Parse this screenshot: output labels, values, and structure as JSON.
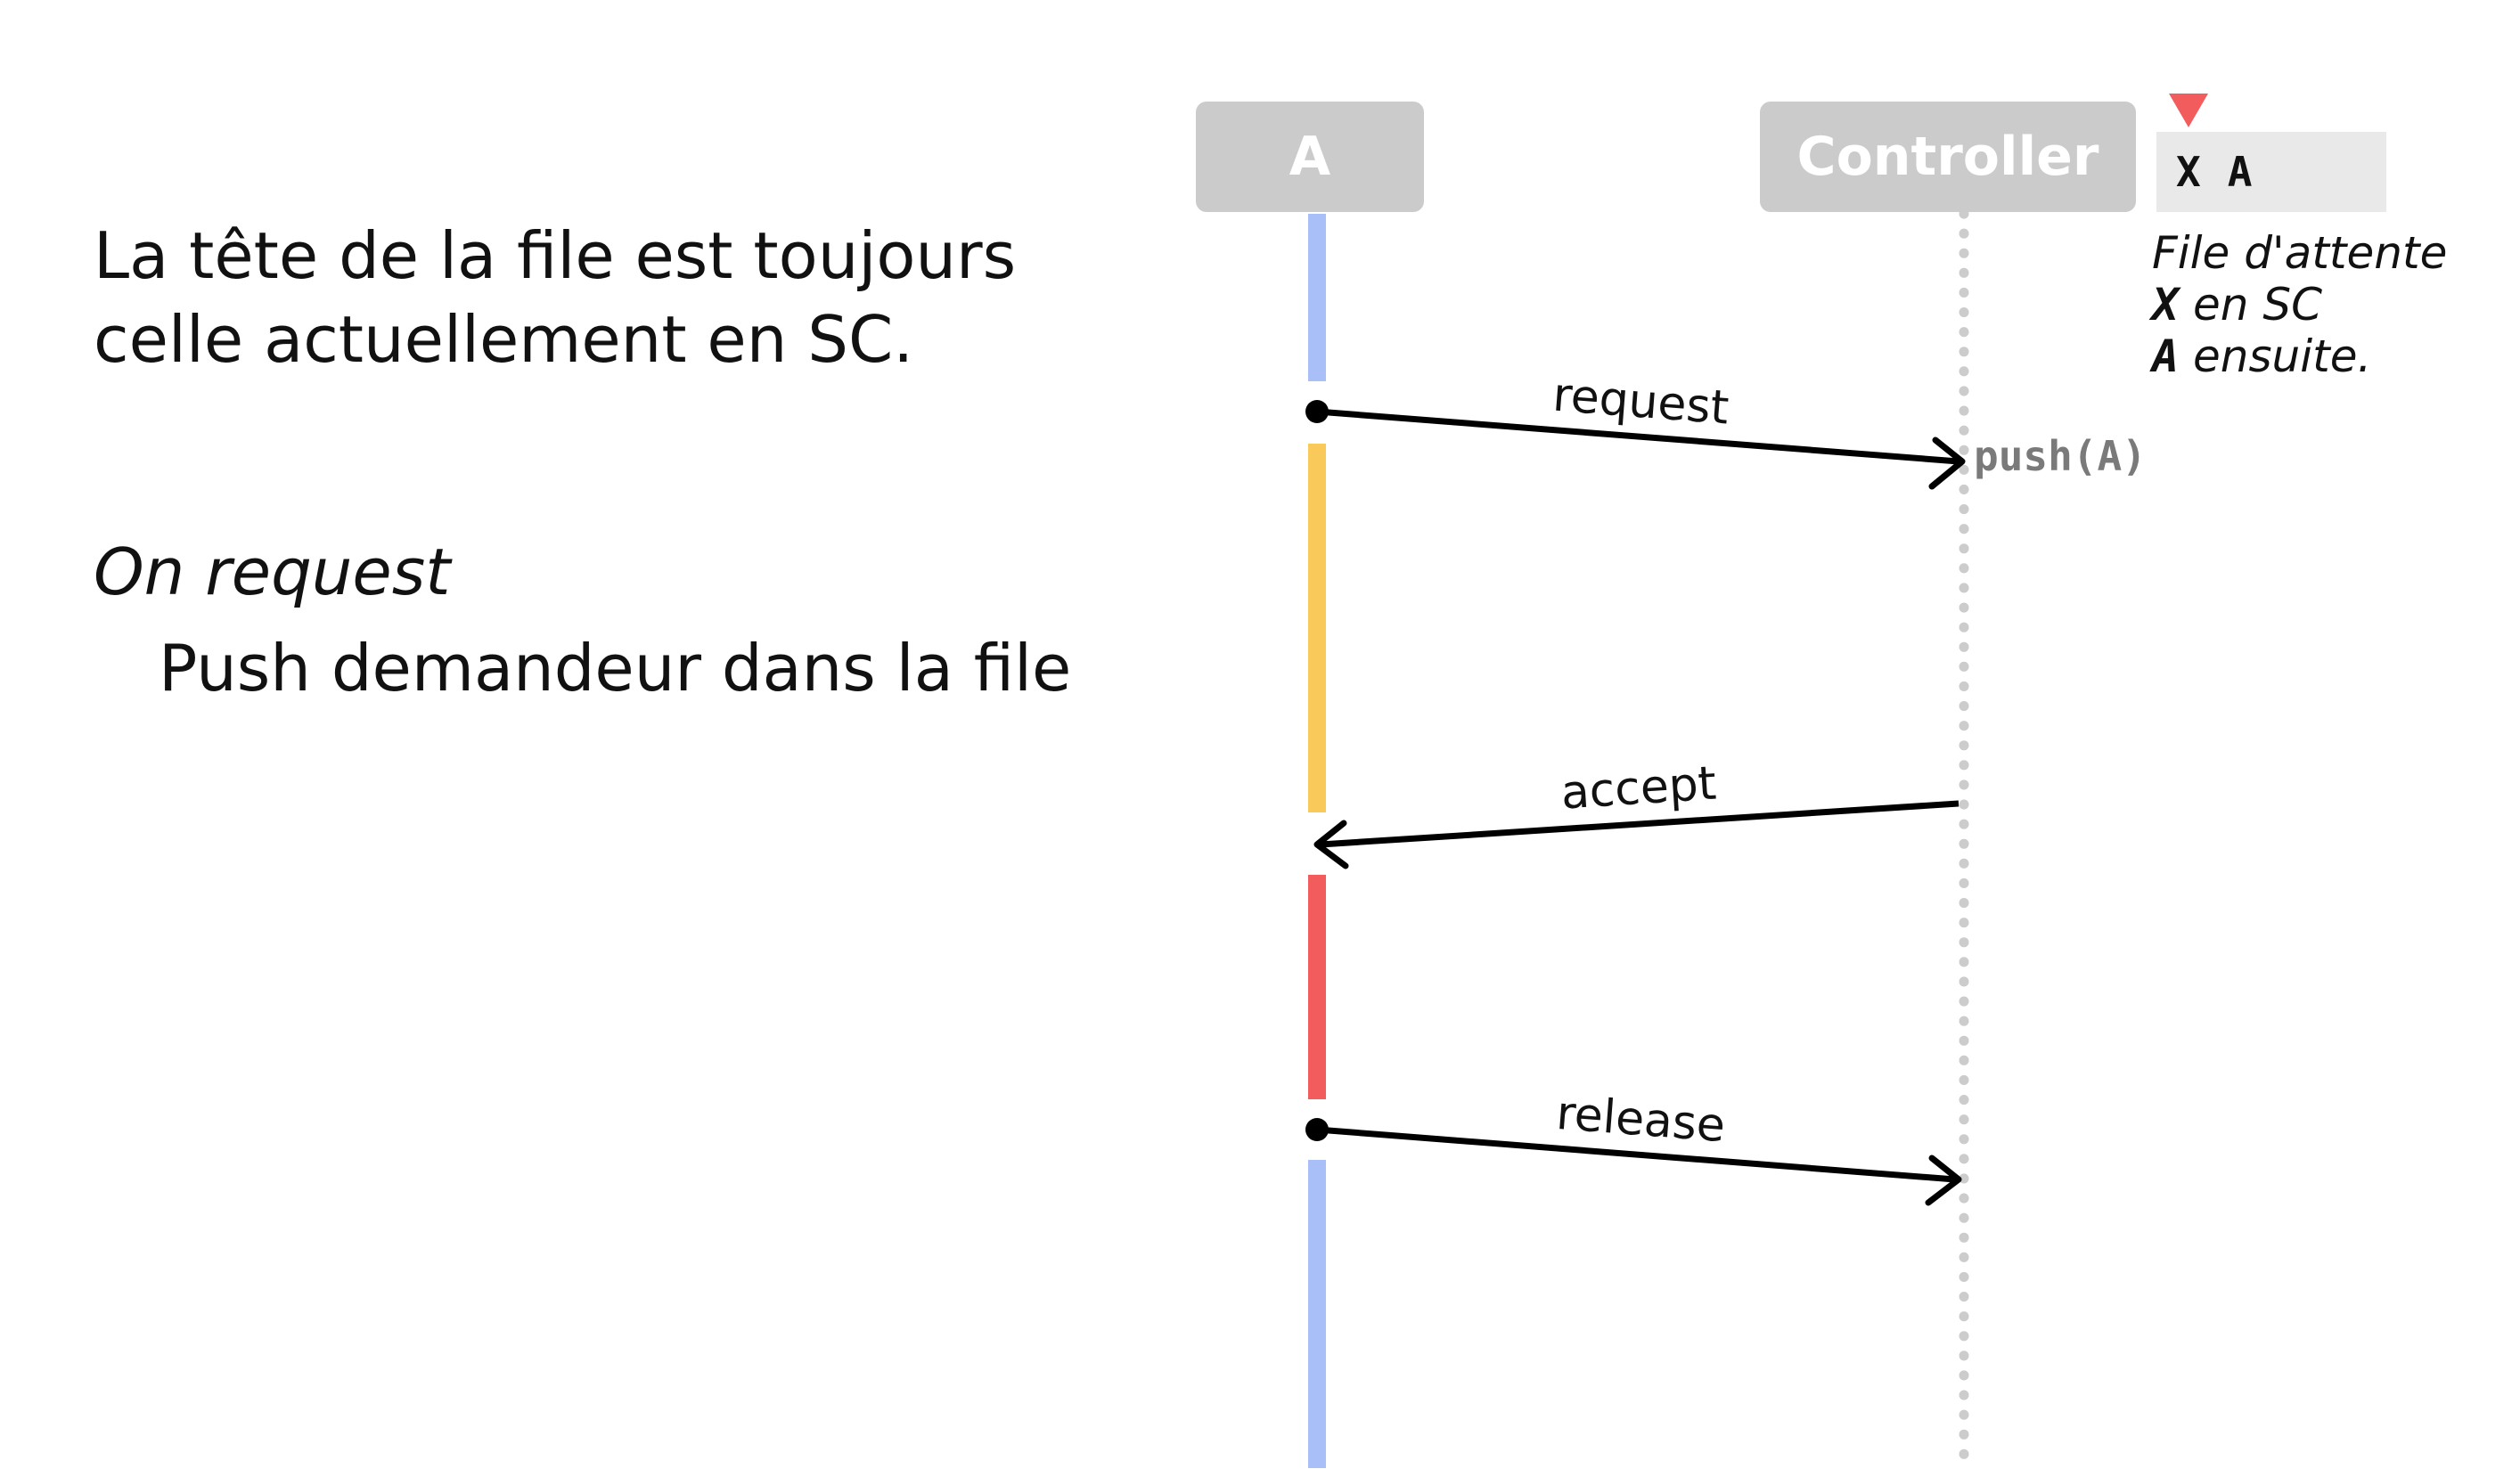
{
  "explanation": {
    "line1": "La tête de la file est toujours",
    "line2": "celle actuellement en SC.",
    "handler_title": "On request",
    "handler_action": "Push demandeur dans la file"
  },
  "participants": {
    "a": "A",
    "controller": "Controller"
  },
  "queue": {
    "items": [
      "X",
      "A"
    ],
    "note_line1": "File d'attente",
    "note_line2_code": "X",
    "note_line2_text": " en SC",
    "note_line3_code": "A",
    "note_line3_text": " ensuite."
  },
  "controller_action": "push(A)",
  "messages": {
    "request": "request",
    "accept": "accept",
    "release": "release"
  },
  "colors": {
    "idle": "#a8bff8",
    "waiting": "#f9c959",
    "critical_section": "#f25c5c",
    "participant_box": "#cbcbcb",
    "lifeline_dotted": "#cccccc"
  }
}
